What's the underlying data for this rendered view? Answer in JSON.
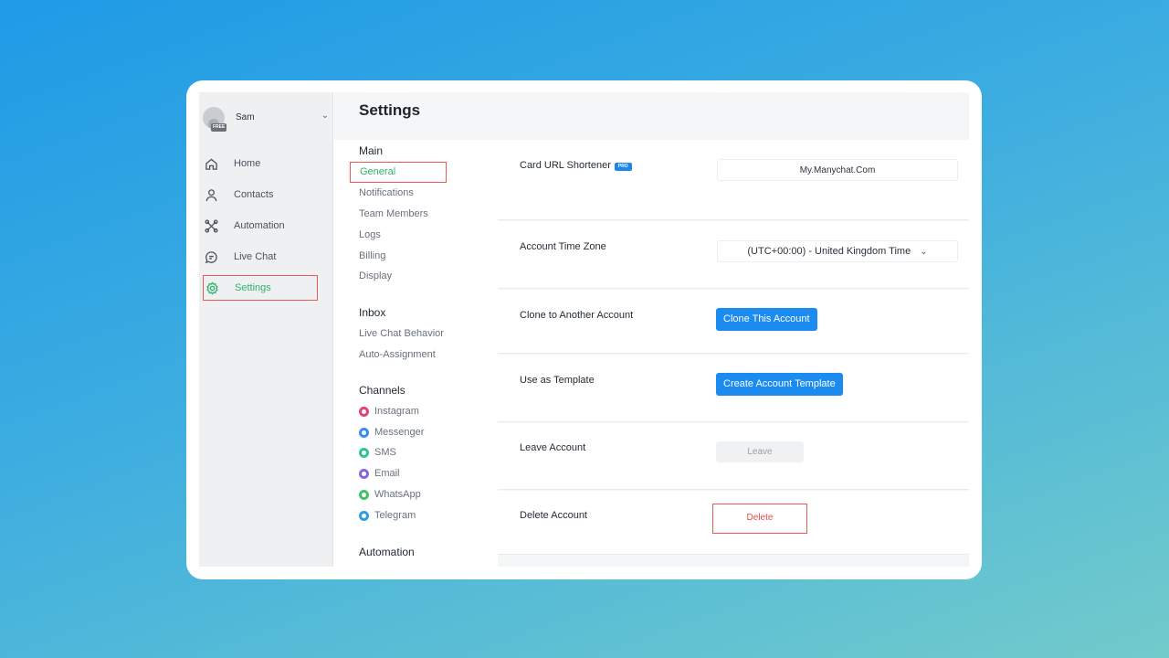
{
  "user": {
    "name": "Sam",
    "badge": "FREE"
  },
  "sidebar": {
    "items": [
      {
        "label": "Home",
        "icon": "home-icon",
        "active": false
      },
      {
        "label": "Contacts",
        "icon": "person-icon",
        "active": false
      },
      {
        "label": "Automation",
        "icon": "automation-icon",
        "active": false
      },
      {
        "label": "Live Chat",
        "icon": "chat-bubble-icon",
        "active": false
      },
      {
        "label": "Settings",
        "icon": "gear-icon",
        "active": true
      }
    ]
  },
  "page": {
    "title": "Settings"
  },
  "submenu": {
    "main_heading": "Main",
    "main_items": [
      "General",
      "Notifications",
      "Team Members",
      "Logs",
      "Billing",
      "Display"
    ],
    "active_item": "General",
    "inbox_heading": "Inbox",
    "inbox_items": [
      "Live Chat Behavior",
      "Auto-Assignment"
    ],
    "channels_heading": "Channels",
    "channels": [
      {
        "label": "Instagram",
        "color": "#e4407a"
      },
      {
        "label": "Messenger",
        "color": "#3b8cf2"
      },
      {
        "label": "SMS",
        "color": "#2fc39a"
      },
      {
        "label": "Email",
        "color": "#8a63e0"
      },
      {
        "label": "WhatsApp",
        "color": "#3fc46a"
      },
      {
        "label": "Telegram",
        "color": "#2d9fe0"
      }
    ],
    "automation_heading": "Automation"
  },
  "settings": {
    "url_shortener": {
      "label": "Card URL Shortener",
      "badge": "PRO",
      "value": "My.Manychat.Com"
    },
    "time_zone": {
      "label": "Account Time Zone",
      "value": "(UTC+00:00) - United Kingdom Time"
    },
    "clone": {
      "label": "Clone to Another Account",
      "button": "Clone This Account"
    },
    "template": {
      "label": "Use as Template",
      "button": "Create Account Template"
    },
    "leave": {
      "label": "Leave Account",
      "button": "Leave"
    },
    "delete": {
      "label": "Delete Account",
      "button": "Delete"
    }
  },
  "colors": {
    "accent": "#1b8bf0",
    "active_text": "#2fb36c",
    "highlight": "#e85a56",
    "danger": "#e24c44"
  }
}
